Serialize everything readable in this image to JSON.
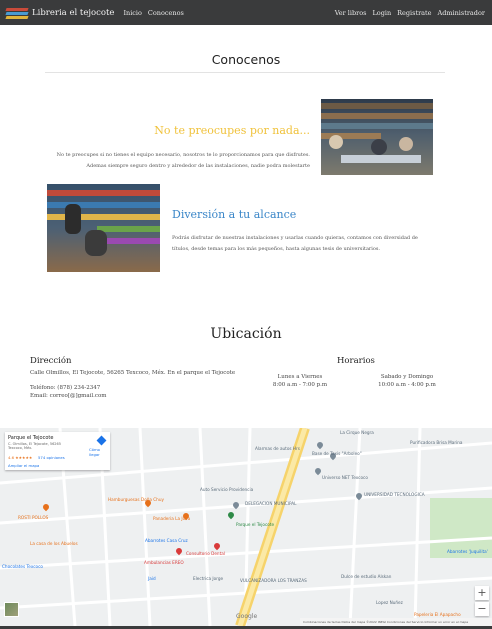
{
  "navbar": {
    "brand": "Libreria el tejocote",
    "left_links": [
      "Inicio",
      "Conocenos"
    ],
    "right_links": [
      "Ver libros",
      "Login",
      "Registrate",
      "Administrador"
    ]
  },
  "conocenos": {
    "title": "Conocenos",
    "feature1": {
      "title": "No te preocupes por nada...",
      "text": "No te preocupes si no tienes el equipo necesario, nosotros te lo proporcionamos para que disfrutes. Ademas siempre seguro dentro y alrededor de las instalaciones, nadie podra molestarte"
    },
    "feature2": {
      "title": "Diversión a tu alcance",
      "text": "Podrás disfrutar de nuestras instalaciones y usarlas cuando quieras, contamos con diversidad de títulos, desde temas para los más pequeños, hasta algunas tesis de universitarios."
    }
  },
  "ubicacion": {
    "title": "Ubicación",
    "direccion": {
      "heading": "Dirección",
      "address": "Calle Olmillos, El Tejocote, 56265 Texcoco, Méx. En el parque el Tejocote",
      "phone": "Teléfono: (878) 234-2347",
      "email": "Email: correo[@]gmail.com"
    },
    "horarios": {
      "heading": "Horarios",
      "weekday_label": "Lunes a Viernes",
      "weekday_hours": "8:00 a.m - 7:00 p.m",
      "weekend_label": "Sabado y Domingo",
      "weekend_hours": "10:00 a.m - 4:00 p.m"
    }
  },
  "map": {
    "card": {
      "title": "Parque el Tejocote",
      "address": "C. Olmillos, El Tejocote, 56265 Texcoco, Méx.",
      "rating": "4.6 ★★★★★",
      "reviews": "574 opiniones",
      "larger_map": "Ampliar el mapa",
      "directions": "Cómo llegar"
    },
    "places": [
      "Alarmas de autos Hrs",
      "Base de Taxis \"Arboleo\"",
      "Purificadora Brisa Marina",
      "La Cirque Negra",
      "Universo NET Texcoco",
      "Auto Servicio Providencia",
      "DELEGACION MUNICIPAL",
      "UNIVERSIDAD TECNOLOGICA",
      "Hamburguesas Doña Chuy",
      "ROSTI POLLOS",
      "Panaderia La Jova",
      "Parque el Tejocote",
      "La casa de los Abuelos",
      "Abarrotes Casa Cruz",
      "Consultorio Dental",
      "Ambulancias EREO",
      "Jaid",
      "Electrica Jorge",
      "VULCANIZADORA LOS TRANZAS",
      "Dulce de estudio Alskan",
      "Abarrotes 'Juquilita'",
      "Chocolates Texcoco",
      "Papeleria El Apapacho",
      "Lopez Nuñez"
    ],
    "google": "Google",
    "attribution": "Combinaciones de teclas   Datos del mapa ©2022 INEGI   Condiciones del Servicio   Informar un error en el mapa",
    "zoom_in": "+",
    "zoom_out": "−"
  }
}
